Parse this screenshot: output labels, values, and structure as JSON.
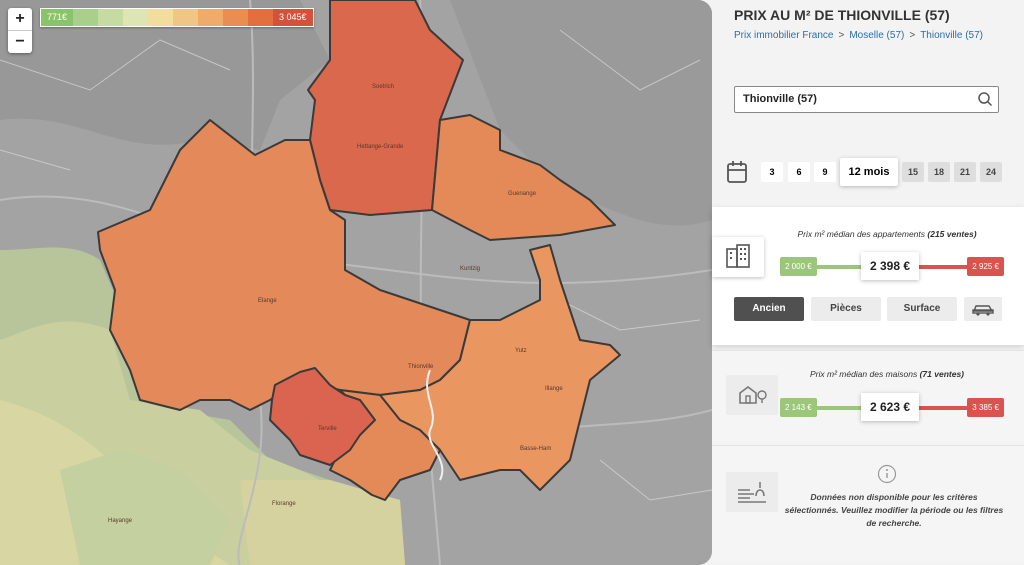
{
  "map": {
    "legend": {
      "min_label": "771€",
      "max_label": "3 045€",
      "colors": [
        "#8ac46a",
        "#a9d08a",
        "#c6dba1",
        "#dde6b2",
        "#f2dd9f",
        "#f0c684",
        "#eeab6a",
        "#ea8d52",
        "#e2703f",
        "#d4513a"
      ]
    },
    "zoom": {
      "in_label": "+",
      "out_label": "−"
    },
    "labels": [
      {
        "name": "Soetrich",
        "text": "Soetrich"
      },
      {
        "name": "Hettange-Grande",
        "text": "Hettange-Grande"
      },
      {
        "name": "Guenange",
        "text": "Guenange"
      },
      {
        "name": "Elange",
        "text": "Elange"
      },
      {
        "name": "Thionville",
        "text": "Thionville"
      },
      {
        "name": "Yutz",
        "text": "Yutz"
      },
      {
        "name": "Terville",
        "text": "Terville"
      },
      {
        "name": "Hayange",
        "text": "Hayange"
      },
      {
        "name": "Florange",
        "text": "Florange"
      },
      {
        "name": "Kuntzig",
        "text": "Kuntzig"
      },
      {
        "name": "Illange",
        "text": "Illange"
      },
      {
        "name": "Basse-Ham",
        "text": "Basse-Ham"
      }
    ]
  },
  "page": {
    "title": "PRIX AU M² DE THIONVILLE (57)",
    "breadcrumbs": [
      "Prix immobilier France",
      "Moselle (57)",
      "Thionville (57)"
    ],
    "breadcrumb_sep": ">"
  },
  "search": {
    "value": "Thionville (57)",
    "icon": "search-icon"
  },
  "periods": {
    "icon": "calendar-icon",
    "items": [
      "3",
      "6",
      "9",
      "12 mois",
      "15",
      "18",
      "21",
      "24"
    ],
    "selected": "12 mois"
  },
  "apartments": {
    "caption_prefix": "Prix m² médian des appartements",
    "caption_count": "(215 ventes)",
    "low": "2 000 €",
    "median": "2 398 €",
    "high": "2 925 €",
    "tabs": [
      "Ancien",
      "Pièces",
      "Surface"
    ],
    "tab_selected": "Ancien",
    "car_icon": "car-icon",
    "icon": "building-icon"
  },
  "houses": {
    "caption_prefix": "Prix m² médian des maisons",
    "caption_count": "(71 ventes)",
    "low": "2 143 €",
    "median": "2 623 €",
    "high": "3 385 €",
    "icon": "house-icon"
  },
  "land": {
    "icon": "land-icon",
    "info_icon": "info-icon",
    "message": "Données non disponible pour les critères sélectionnés. Veuillez modifier la période ou les filtres de recherche."
  },
  "colors": {
    "low_green": "#9cc67a",
    "high_red": "#d9534f",
    "link_blue": "#2a6fa8",
    "tab_dark": "#505050"
  }
}
